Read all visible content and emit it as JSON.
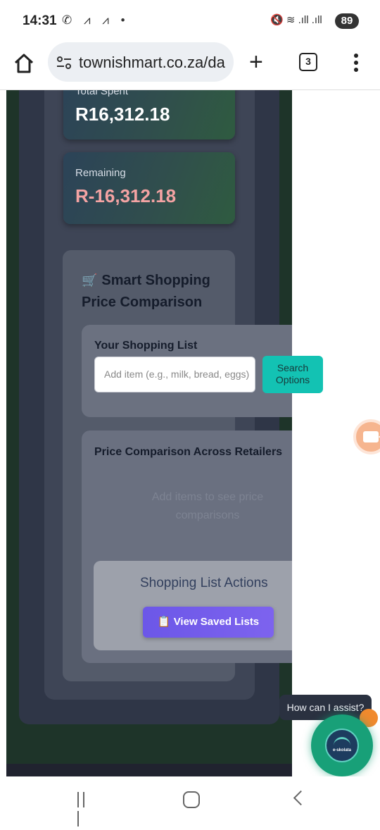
{
  "status_bar": {
    "time": "14:31",
    "notification_icons": "✆ ⩘ ⩘ •",
    "right_icons": "🔇 ≋ .ıll .ıll",
    "battery": "89"
  },
  "browser": {
    "url": "townishmart.co.za/da",
    "tab_count": "3"
  },
  "dashboard": {
    "total_spent_label": "Total Spent",
    "total_spent_value": "R16,312.18",
    "remaining_label": "Remaining",
    "remaining_value": "R-16,312.18",
    "colors": {
      "spent_value": "#ffffff",
      "remaining_value": "#f4a3a3"
    }
  },
  "smart_shopping": {
    "icon": "🛒",
    "title": "Smart Shopping Price Comparison",
    "list_title": "Your Shopping List",
    "item_placeholder": "Add item (e.g., milk, bread, eggs)",
    "search_button": "Search Options",
    "comparison_title": "Price Comparison Across Retailers",
    "comparison_empty": "Add items to see price comparisons",
    "actions_title": "Shopping List Actions",
    "view_saved_icon": "📋",
    "view_saved_label": "View Saved Lists"
  },
  "assistant": {
    "tooltip": "How can I assist?",
    "brand": "e-skolata"
  },
  "icons": {
    "home": "home-icon",
    "site_settings": "tune-icon",
    "new_tab": "plus-icon",
    "menu": "kebab-menu-icon",
    "video": "video-camera-icon",
    "nav_recent": "recent-apps-icon",
    "nav_home": "home-button-icon",
    "nav_back": "back-icon"
  }
}
